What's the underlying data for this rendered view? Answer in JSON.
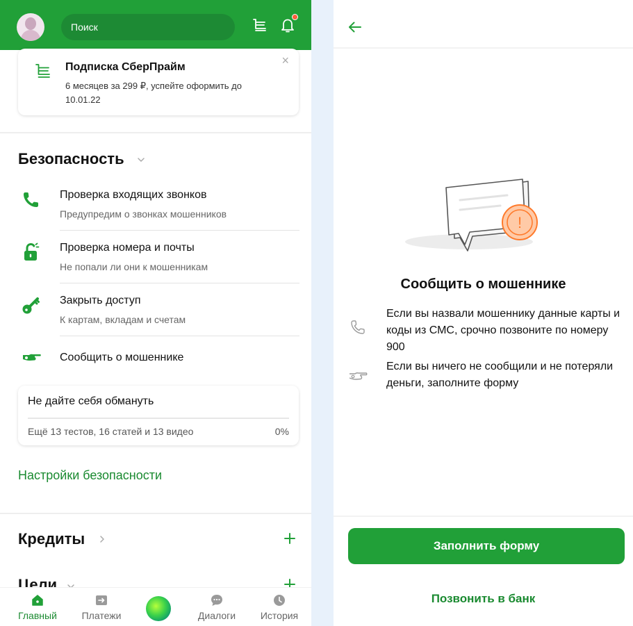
{
  "left": {
    "search": {
      "label": "Поиск"
    },
    "promo": {
      "title": "Подписка СберПрайм",
      "text": "6 месяцев за 299 ₽, успейте оформить до 10.01.22",
      "close": "×"
    },
    "security": {
      "title": "Безопасность",
      "items": [
        {
          "title": "Проверка входящих звонков",
          "subtitle": "Предупредим о звонках мошенников",
          "icon": "phone-icon"
        },
        {
          "title": "Проверка номера и почты",
          "subtitle": "Не попали ли они к мошенникам",
          "icon": "lock-icon"
        },
        {
          "title": "Закрыть доступ",
          "subtitle": "К картам, вкладам и счетам",
          "icon": "key-icon"
        },
        {
          "title": "Сообщить о мошеннике",
          "subtitle": "",
          "icon": "pointing-hand-icon"
        }
      ],
      "tips": {
        "title": "Не дайте себя обмануть",
        "subtitle": "Ещё 13 тестов, 16 статей и 13 видео",
        "progress": "0%"
      },
      "settings_link": "Настройки безопасности"
    },
    "credits": {
      "title": "Кредиты"
    },
    "goals": {
      "title": "Цели"
    },
    "nav": [
      {
        "label": "Главный",
        "icon": "home-icon",
        "active": true
      },
      {
        "label": "Платежи",
        "icon": "transfer-icon",
        "active": false
      },
      {
        "label": "",
        "icon": "assistant-orb",
        "active": false
      },
      {
        "label": "Диалоги",
        "icon": "chat-icon",
        "active": false
      },
      {
        "label": "История",
        "icon": "clock-icon",
        "active": false
      }
    ],
    "colors": {
      "brand": "#21a038",
      "link": "#1a8a30",
      "badge": "#ff5e3a"
    }
  },
  "right": {
    "title": "Сообщить о мошеннике",
    "info": [
      {
        "icon": "phone-outline-icon",
        "text": "Если вы назвали мошеннику данные карты и коды из СМС, срочно позвоните по номеру 900"
      },
      {
        "icon": "pointing-hand-outline-icon",
        "text": "Если вы ничего не сообщили и не потеряли деньги, заполните форму"
      }
    ],
    "primary_button": "Заполнить форму",
    "secondary_button": "Позвонить в банк",
    "illustration_mark": "!"
  }
}
